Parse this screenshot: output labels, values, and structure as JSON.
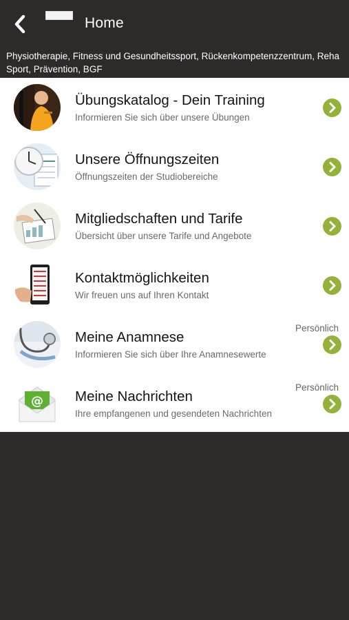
{
  "header": {
    "title": "Home",
    "subtitle": "Physiotherapie, Fitness und Gesundheitssport, Rückenkompetenzzentrum, Reha Sport, Prävention, BGF"
  },
  "items": [
    {
      "title": "Übungskatalog - Dein Training",
      "subtitle": "Informieren Sie sich über unsere Übungen",
      "badge": ""
    },
    {
      "title": "Unsere Öffnungszeiten",
      "subtitle": "Öffnungszeiten der Studiobereiche",
      "badge": ""
    },
    {
      "title": "Mitgliedschaften und Tarife",
      "subtitle": "Übersicht über unsere Tarife und Angebote",
      "badge": ""
    },
    {
      "title": "Kontaktmöglichkeiten",
      "subtitle": "Wir freuen uns auf Ihren Kontakt",
      "badge": ""
    },
    {
      "title": "Meine Anamnese",
      "subtitle": "Informieren Sie sich über Ihre Anamnesewerte",
      "badge": "Persönlich"
    },
    {
      "title": "Meine Nachrichten",
      "subtitle": "Ihre empfangenen und gesendeten Nachrichten",
      "badge": "Persönlich"
    }
  ],
  "icons": {
    "back": "chevron-left-icon",
    "item_arrow": "chevron-right-circle-icon",
    "thumbnails": [
      "training-photo",
      "clock-calendar-photo",
      "tariff-document-photo",
      "contact-phone-photo",
      "stethoscope-photo",
      "mail-envelope-icon"
    ]
  },
  "colors": {
    "header_bg": "#2d2a29",
    "list_bg": "#ffffff",
    "accent_green": "#94b23a",
    "title_text": "#141414",
    "subtitle_text": "#6a6a6a"
  }
}
